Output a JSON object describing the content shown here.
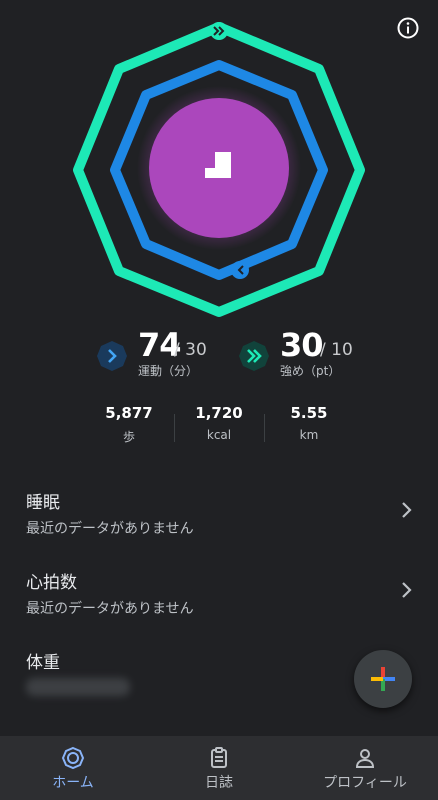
{
  "colors": {
    "background": "#202124",
    "intensity_ring": "#1de9b6",
    "move_ring": "#1e88e5",
    "center": "#ab47bc",
    "active_nav": "#8ab4f8"
  },
  "stats": {
    "move": {
      "value": "74",
      "goal": "/ 30",
      "label": "運動（分）",
      "icon": "chevron-right-icon"
    },
    "intensity": {
      "value": "30",
      "goal": "/ 10",
      "label": "強め（pt）",
      "icon": "double-chevron-icon"
    }
  },
  "metrics": [
    {
      "value": "5,877",
      "unit": "歩"
    },
    {
      "value": "1,720",
      "unit": "kcal"
    },
    {
      "value": "5.55",
      "unit": "km"
    }
  ],
  "list": [
    {
      "title": "睡眠",
      "subtitle": "最近のデータがありません"
    },
    {
      "title": "心拍数",
      "subtitle": "最近のデータがありません"
    },
    {
      "title": "体重",
      "subtitle": ""
    }
  ],
  "nav": [
    {
      "label": "ホーム",
      "icon": "home-icon",
      "active": true
    },
    {
      "label": "日誌",
      "icon": "journal-icon",
      "active": false
    },
    {
      "label": "プロフィール",
      "icon": "profile-icon",
      "active": false
    }
  ]
}
